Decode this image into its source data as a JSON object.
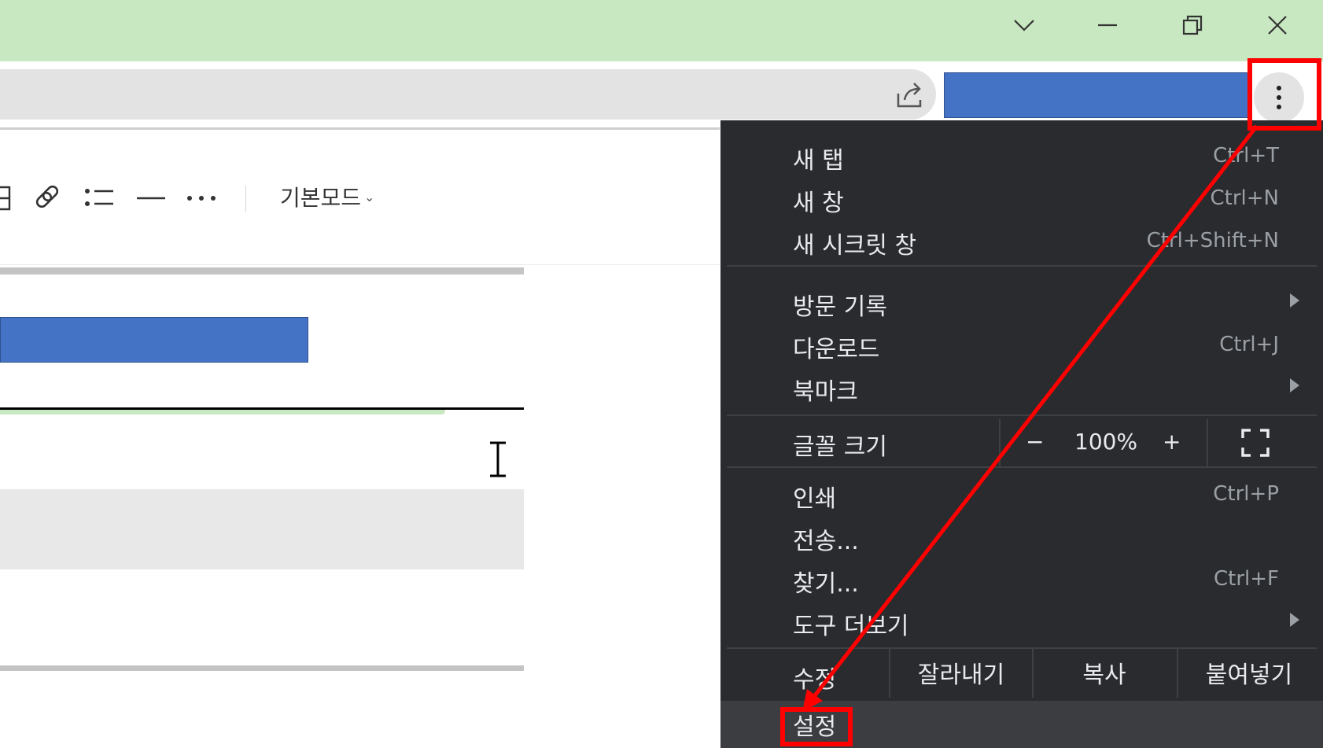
{
  "toolbar": {
    "mode_label": "기본모드"
  },
  "menu": {
    "items": [
      {
        "label": "새 탭",
        "shortcut": "Ctrl+T"
      },
      {
        "label": "새 창",
        "shortcut": "Ctrl+N"
      },
      {
        "label": "새 시크릿 창",
        "shortcut": "Ctrl+Shift+N"
      },
      {
        "label": "방문 기록",
        "shortcut": ""
      },
      {
        "label": "다운로드",
        "shortcut": "Ctrl+J"
      },
      {
        "label": "북마크",
        "shortcut": ""
      },
      {
        "label": "인쇄",
        "shortcut": "Ctrl+P"
      },
      {
        "label": "전송...",
        "shortcut": ""
      },
      {
        "label": "찾기...",
        "shortcut": "Ctrl+F"
      },
      {
        "label": "도구 더보기",
        "shortcut": ""
      }
    ],
    "zoom": {
      "label": "글꼴 크기",
      "minus": "−",
      "value": "100%",
      "plus": "+"
    },
    "edit": {
      "label": "수정",
      "cut": "잘라내기",
      "copy": "복사",
      "paste": "붙여넣기"
    },
    "settings_label": "설정"
  },
  "annotation_color": "#ff0000"
}
